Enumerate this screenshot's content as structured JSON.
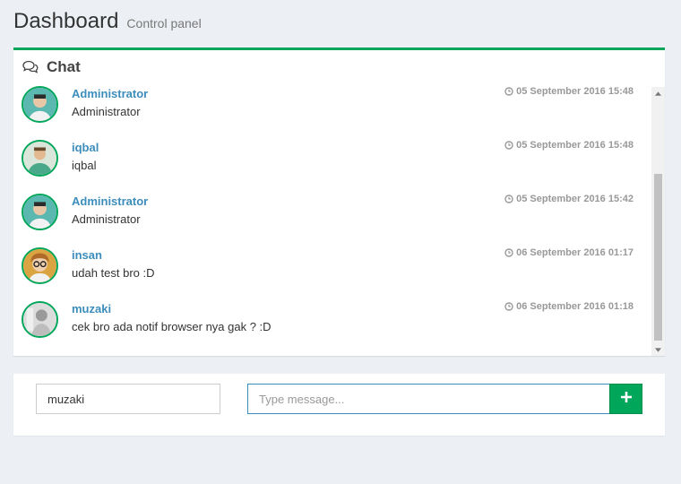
{
  "header": {
    "title": "Dashboard",
    "subtitle": "Control panel"
  },
  "chat_box": {
    "title": "Chat",
    "icon": "comments-icon",
    "accent_color": "#00a65a"
  },
  "messages": [
    {
      "name": "Administrator",
      "text": "Administrator",
      "time": "05 September 2016 15:48",
      "avatar": "avatar-male-teal"
    },
    {
      "name": "iqbal",
      "text": "iqbal",
      "time": "05 September 2016 15:48",
      "avatar": "avatar-male-green"
    },
    {
      "name": "Administrator",
      "text": "Administrator",
      "time": "05 September 2016 15:42",
      "avatar": "avatar-male-teal"
    },
    {
      "name": "insan",
      "text": "udah test bro :D",
      "time": "06 September 2016 01:17",
      "avatar": "avatar-female-glasses"
    },
    {
      "name": "muzaki",
      "text": "cek bro ada notif browser nya gak ? :D",
      "time": "06 September 2016 01:18",
      "avatar": "avatar-grey-photo"
    }
  ],
  "composer": {
    "name_value": "muzaki",
    "message_placeholder": "Type message...",
    "send_icon": "plus-icon"
  }
}
